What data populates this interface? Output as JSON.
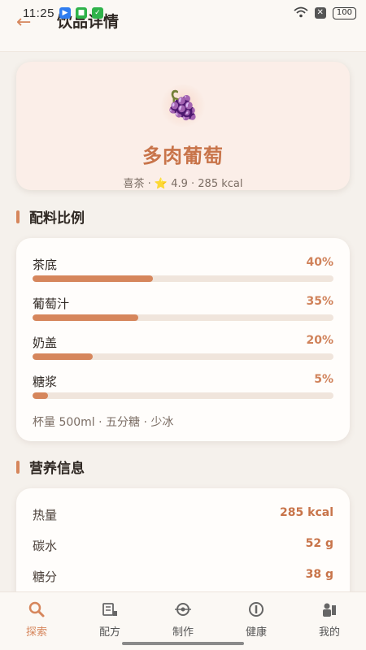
{
  "status": {
    "time": "11:25",
    "battery": "100"
  },
  "header": {
    "title": "饮品详情"
  },
  "drink": {
    "icon": "grape-icon",
    "emoji": "🍇",
    "name": "多肉葡萄",
    "meta": "喜茶 · ⭐ 4.9 · 285 kcal"
  },
  "ingredients": {
    "section_title": "配料比例",
    "items": [
      {
        "name": "茶底",
        "percent_label": "40%",
        "percent": 40
      },
      {
        "name": "葡萄汁",
        "percent_label": "35%",
        "percent": 35
      },
      {
        "name": "奶盖",
        "percent_label": "20%",
        "percent": 20
      },
      {
        "name": "糖浆",
        "percent_label": "5%",
        "percent": 5
      }
    ],
    "cup_info": "杯量 500ml · 五分糖 · 少冰"
  },
  "nutrition": {
    "section_title": "营养信息",
    "items": [
      {
        "label": "热量",
        "value": "285 kcal"
      },
      {
        "label": "碳水",
        "value": "52 g"
      },
      {
        "label": "糖分",
        "value": "38 g"
      }
    ]
  },
  "nav": {
    "items": [
      {
        "label": "探索",
        "icon": "search-icon",
        "active": true
      },
      {
        "label": "配方",
        "icon": "recipe-icon",
        "active": false
      },
      {
        "label": "制作",
        "icon": "make-icon",
        "active": false
      },
      {
        "label": "健康",
        "icon": "health-icon",
        "active": false
      },
      {
        "label": "我的",
        "icon": "profile-icon",
        "active": false
      }
    ]
  },
  "colors": {
    "accent": "#d6865c",
    "background": "#f5f1ec",
    "hero": "#fbeee8"
  }
}
